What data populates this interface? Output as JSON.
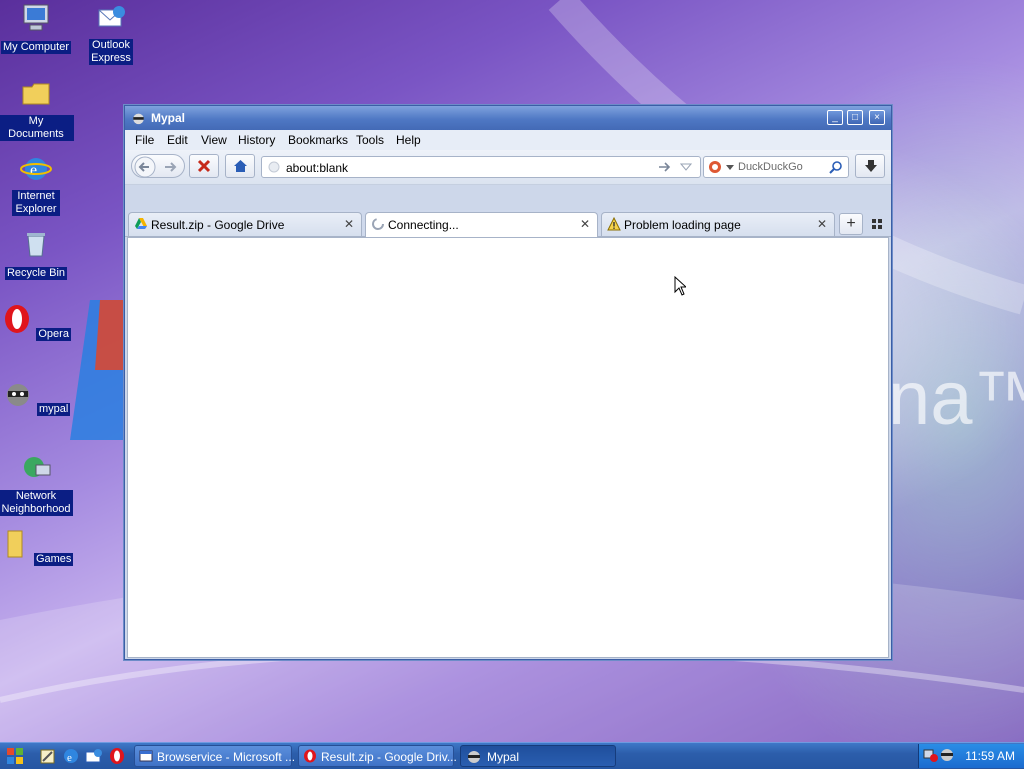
{
  "desktop": {
    "icons": [
      {
        "label": "My Computer"
      },
      {
        "label": "Outlook Express"
      },
      {
        "label": "My Documents"
      },
      {
        "label": "Internet Explorer"
      },
      {
        "label": "Recycle Bin"
      },
      {
        "label": "Opera"
      },
      {
        "label": "mypal"
      },
      {
        "label": "Network Neighborhood"
      },
      {
        "label": "Games"
      }
    ],
    "wallpaper_text": "na™"
  },
  "window": {
    "title": "Mypal",
    "controls": {
      "minimize": "_",
      "maximize": "□",
      "close": "×"
    },
    "menu": [
      "File",
      "Edit",
      "View",
      "History",
      "Bookmarks",
      "Tools",
      "Help"
    ],
    "url": "about:blank",
    "search_placeholder": "DuckDuckGo",
    "tabs": [
      {
        "label": "Result.zip - Google Drive",
        "selected": false
      },
      {
        "label": "Connecting...",
        "selected": true
      },
      {
        "label": "Problem loading page",
        "selected": false
      }
    ],
    "new_tab": "+"
  },
  "taskbar": {
    "buttons": [
      {
        "label": "Browservice - Microsoft ..."
      },
      {
        "label": "Result.zip - Google Driv..."
      },
      {
        "label": "Mypal"
      }
    ],
    "clock": "11:59 AM"
  }
}
